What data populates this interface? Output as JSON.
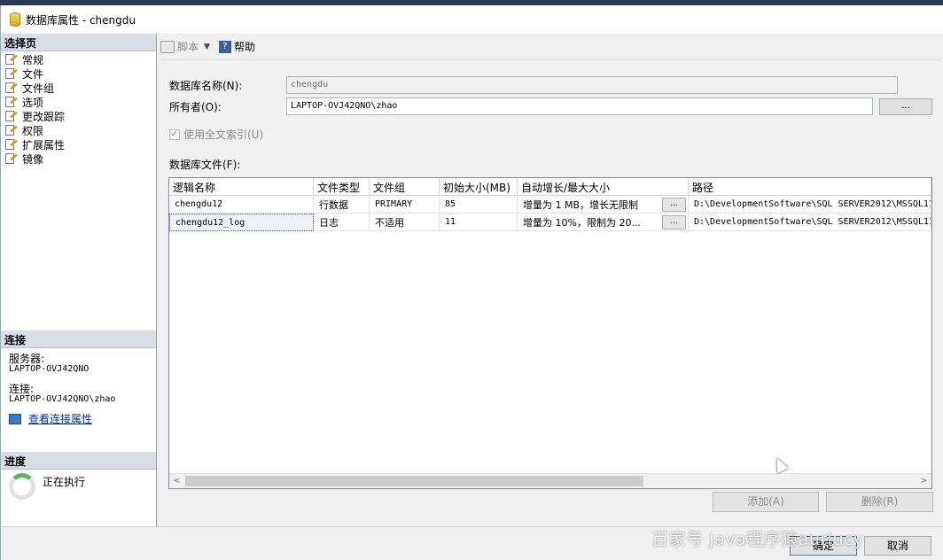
{
  "window": {
    "title": "数据库属性 - chengdu"
  },
  "left": {
    "select_page_header": "选择页",
    "pages": [
      {
        "label": "常规"
      },
      {
        "label": "文件"
      },
      {
        "label": "文件组"
      },
      {
        "label": "选项"
      },
      {
        "label": "更改跟踪"
      },
      {
        "label": "权限"
      },
      {
        "label": "扩展属性"
      },
      {
        "label": "镜像"
      }
    ],
    "connection_header": "连接",
    "server_label": "服务器:",
    "server_value": "LAPTOP-OVJ42QNO",
    "connection_label": "连接:",
    "connection_value": "LAPTOP-OVJ42QNO\\zhao",
    "view_props_link": "查看连接属性",
    "progress_header": "进度",
    "progress_status": "正在执行"
  },
  "toolbar": {
    "script_label": "脚本",
    "help_label": "帮助"
  },
  "form": {
    "db_name_label": "数据库名称(N):",
    "db_name_value": "chengdu",
    "owner_label": "所有者(O):",
    "owner_value": "LAPTOP-OVJ42QNO\\zhao",
    "owner_browse": "...",
    "fulltext_label": "使用全文索引(U)",
    "fulltext_checked": true,
    "files_label": "数据库文件(F):"
  },
  "grid": {
    "headers": [
      "逻辑名称",
      "文件类型",
      "文件组",
      "初始大小(MB)",
      "自动增长/最大大小",
      "路径"
    ],
    "rows": [
      {
        "logical_name": "chengdu12",
        "file_type": "行数据",
        "filegroup": "PRIMARY",
        "initial_size": "85",
        "autogrowth": "增量为 1 MB，增长无限制",
        "path": "D:\\DevelopmentSoftware\\SQL SERVER2012\\MSSQL11"
      },
      {
        "logical_name": "chengdu12_log",
        "file_type": "日志",
        "filegroup": "不适用",
        "initial_size": "11",
        "autogrowth": "增量为 10%，限制为 20...",
        "path": "D:\\DevelopmentSoftware\\SQL SERVER2012\\MSSQL11"
      }
    ],
    "browse": "...",
    "scroll_left": "<",
    "scroll_right": ">"
  },
  "buttons": {
    "add": "添加(A)",
    "remove": "删除(R)",
    "ok": "确定",
    "cancel": "取消"
  },
  "watermark": "百家号 Java程序猿aurlucy"
}
